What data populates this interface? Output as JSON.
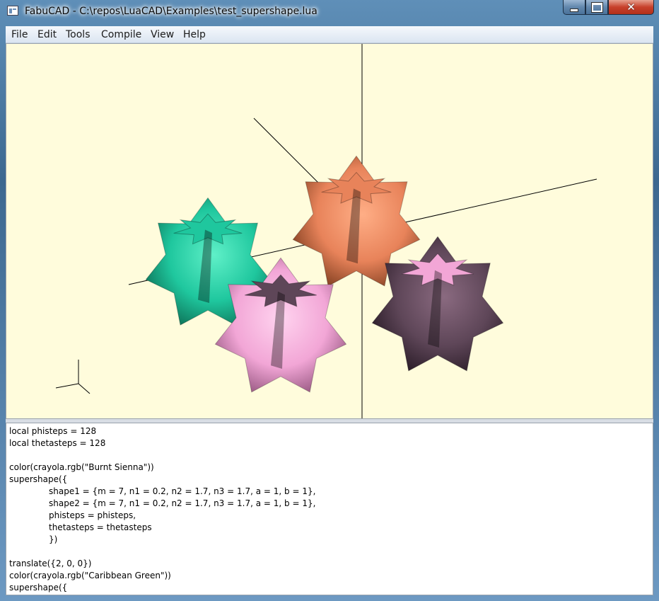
{
  "window": {
    "title": "FabuCAD - C:\\repos\\LuaCAD\\Examples\\test_supershape.lua",
    "controls": {
      "minimize": "minimize-icon",
      "maximize": "maximize-icon",
      "close": "close-icon",
      "close_glyph": "✕"
    }
  },
  "menu": [
    "File",
    "Edit",
    "Tools",
    "Compile",
    "View",
    "Help"
  ],
  "viewport": {
    "background": "#fffcdc",
    "shapes": [
      {
        "name": "supershape-caribbean-green",
        "color": "#1fc79e"
      },
      {
        "name": "supershape-burnt-sienna",
        "color": "#e8835a"
      },
      {
        "name": "supershape-pink",
        "color": "#f2a6d6"
      },
      {
        "name": "supershape-plum",
        "color": "#5e4658"
      }
    ]
  },
  "editor": {
    "lines": [
      {
        "text": "local phisteps = 128",
        "indent": false
      },
      {
        "text": "local thetasteps = 128",
        "indent": false
      },
      {
        "text": "",
        "indent": false
      },
      {
        "text": "color(crayola.rgb(\"Burnt Sienna\"))",
        "indent": false
      },
      {
        "text": "supershape({",
        "indent": false
      },
      {
        "text": "shape1 = {m = 7, n1 = 0.2, n2 = 1.7, n3 = 1.7, a = 1, b = 1},",
        "indent": true
      },
      {
        "text": "shape2 = {m = 7, n1 = 0.2, n2 = 1.7, n3 = 1.7, a = 1, b = 1},",
        "indent": true
      },
      {
        "text": "phisteps = phisteps,",
        "indent": true
      },
      {
        "text": "thetasteps = thetasteps",
        "indent": true
      },
      {
        "text": "})",
        "indent": true
      },
      {
        "text": "",
        "indent": false
      },
      {
        "text": "translate({2, 0, 0})",
        "indent": false
      },
      {
        "text": "color(crayola.rgb(\"Caribbean Green\"))",
        "indent": false
      },
      {
        "text": "supershape({",
        "indent": false
      }
    ]
  }
}
